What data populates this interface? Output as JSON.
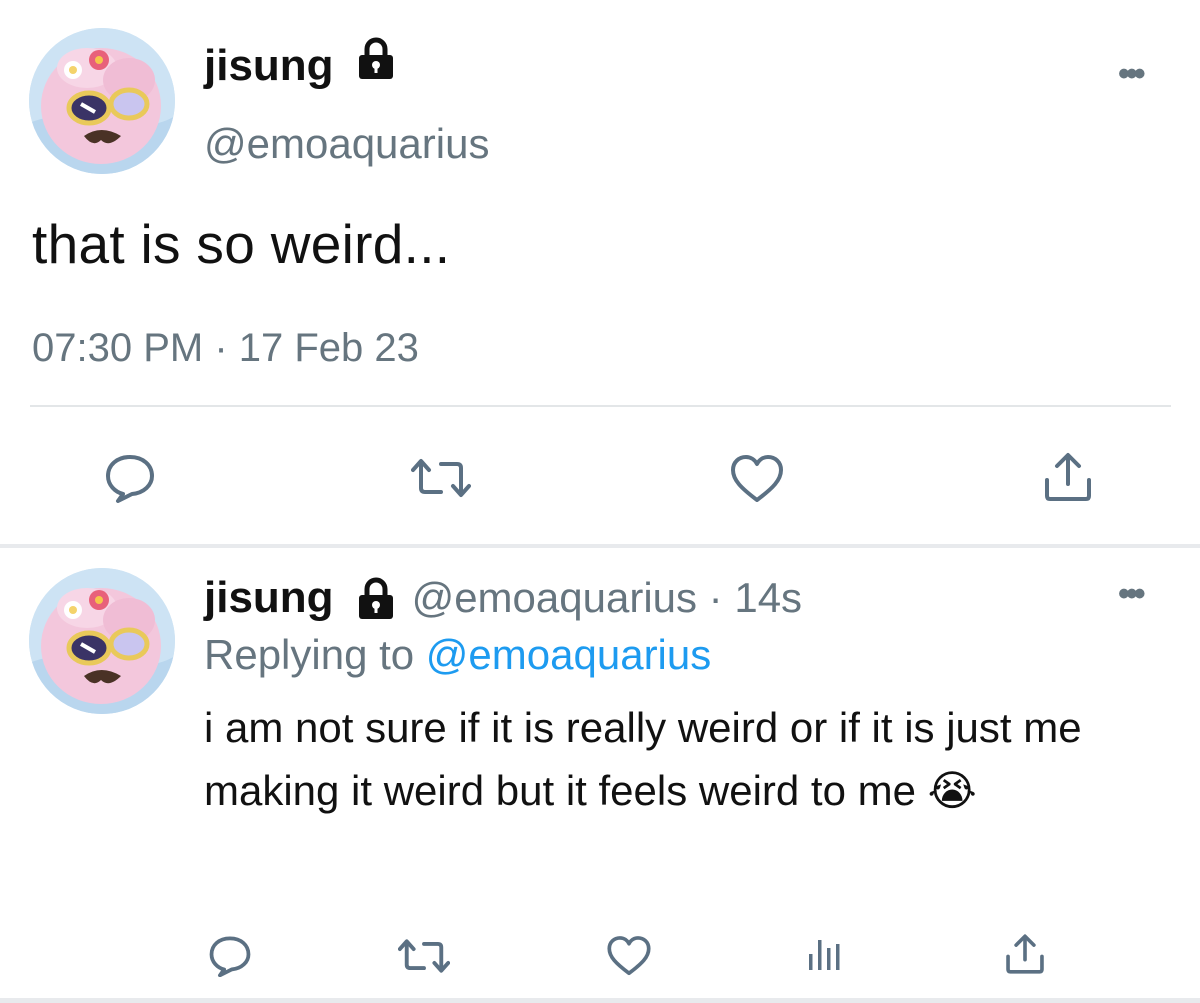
{
  "main_tweet": {
    "display_name": "jisung",
    "handle": "@emoaquarius",
    "text": "that is so weird...",
    "timestamp": "07:30 PM · 17 Feb 23",
    "more_label": "•••"
  },
  "reply_tweet": {
    "display_name": "jisung",
    "handle": "@emoaquarius",
    "separator": " · ",
    "age": "14s",
    "replying_prefix": "Replying to ",
    "replying_to": "@emoaquarius",
    "text": "i am not sure if it is really weird or if it is just me making it weird but it feels weird to me",
    "emoji": "😭",
    "more_label": "•••"
  },
  "icons": {
    "protected": "lock-icon",
    "main_actions": [
      "reply-icon",
      "retweet-icon",
      "like-icon",
      "share-icon"
    ],
    "reply_actions": [
      "reply-icon",
      "retweet-icon",
      "like-icon",
      "analytics-icon",
      "share-icon"
    ]
  },
  "colors": {
    "text": "#111111",
    "secondary": "#66757f",
    "link": "#1d9bf0",
    "divider": "#e3e6e8"
  }
}
